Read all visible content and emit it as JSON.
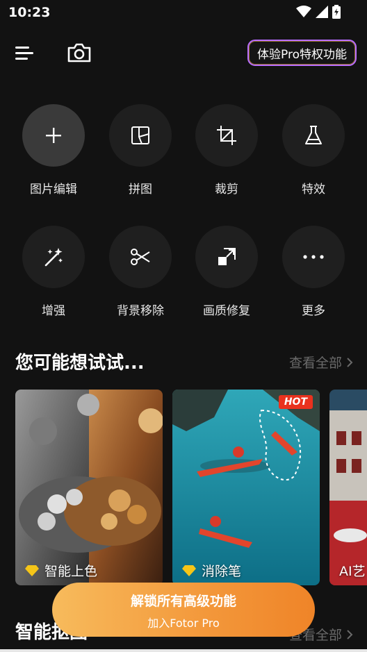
{
  "status_bar": {
    "time": "10:23"
  },
  "header": {
    "pro_trial_label": "体验Pro特权功能"
  },
  "tools": [
    {
      "label": "图片编辑",
      "icon": "plus-icon"
    },
    {
      "label": "拼图",
      "icon": "collage-icon"
    },
    {
      "label": "裁剪",
      "icon": "crop-icon"
    },
    {
      "label": "特效",
      "icon": "flask-icon"
    },
    {
      "label": "增强",
      "icon": "magic-wand-icon"
    },
    {
      "label": "背景移除",
      "icon": "scissors-icon"
    },
    {
      "label": "画质修复",
      "icon": "upscale-icon"
    },
    {
      "label": "更多",
      "icon": "more-dots-icon"
    }
  ],
  "suggestions": {
    "title": "您可能想试试...",
    "see_all": "查看全部",
    "cards": [
      {
        "label": "智能上色",
        "icon": "diamond-icon"
      },
      {
        "label": "消除笔",
        "icon": "diamond-icon",
        "badge": "HOT"
      },
      {
        "label": "AI艺"
      }
    ]
  },
  "smart_section": {
    "title": "智能抠图",
    "see_all": "查看全部"
  },
  "unlock": {
    "title": "解锁所有高级功能",
    "subtitle": "加入Fotor Pro"
  },
  "colors": {
    "background": "#121212",
    "accent_orange": "#f3973a",
    "hot_red": "#e9321e",
    "pro_border": "#b86cff"
  }
}
